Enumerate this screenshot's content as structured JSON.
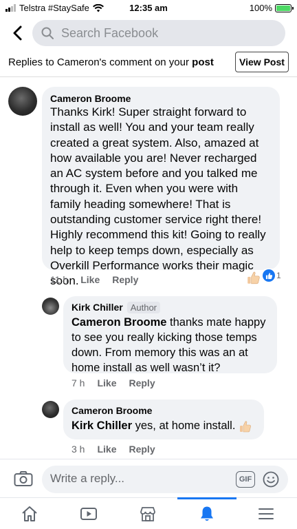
{
  "status": {
    "carrier": "Telstra #StaySafe",
    "time": "12:35 am",
    "battery": "100%"
  },
  "search": {
    "placeholder": "Search Facebook"
  },
  "context": {
    "prefix": "Replies to Cameron's comment on your ",
    "post_word": "post",
    "view_post_label": "View Post"
  },
  "comments": [
    {
      "author": "Cameron Broome",
      "text": "Thanks Kirk! Super straight forward to install as well! You and your team really created a great system. Also, amazed at how available you are! Never recharged an AC system before and you talked me through it. Even when you were with family heading somewhere! That is outstanding customer service right there! Highly recommend this kit! Going to really help to keep temps down, especially as Overkill Performance works their magic soon.",
      "time": "11 h",
      "like_label": "Like",
      "reply_label": "Reply",
      "reaction_count": "1"
    },
    {
      "author": "Kirk Chiller",
      "badge": "Author",
      "mention": "Cameron Broome",
      "text": " thanks mate happy to see you really kicking those temps down. From memory this was an at home install as well wasn’t it?",
      "time": "7 h",
      "like_label": "Like",
      "reply_label": "Reply"
    },
    {
      "author": "Cameron Broome",
      "mention": "Kirk Chiller",
      "text": " yes, at home install.",
      "time": "3 h",
      "like_label": "Like",
      "reply_label": "Reply"
    }
  ],
  "composer": {
    "placeholder": "Write a reply...",
    "gif_label": "GIF"
  },
  "tabs": [
    "home-icon",
    "watch-icon",
    "marketplace-icon",
    "notifications-icon",
    "menu-icon"
  ],
  "colors": {
    "accent": "#1877f2",
    "bubble": "#f0f2f5",
    "meta": "#65676b"
  }
}
